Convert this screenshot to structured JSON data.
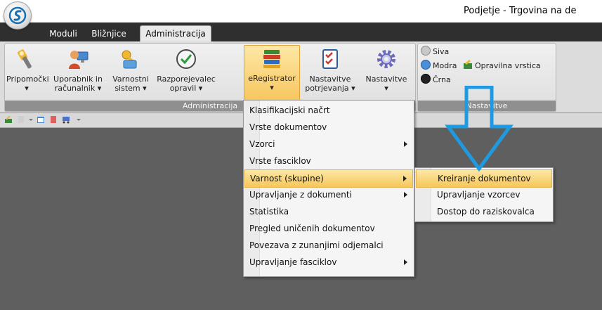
{
  "window": {
    "title": "Podjetje - Trgovina na de"
  },
  "tabs": [
    {
      "label": "Moduli"
    },
    {
      "label": "Bližnjice"
    },
    {
      "label": "Administracija"
    }
  ],
  "ribbon": {
    "group_admin": {
      "label": "Administracija",
      "buttons": [
        {
          "line1": "Pripomočki",
          "line2": "▾",
          "icon": "tools-icon"
        },
        {
          "line1": "Uporabnik in",
          "line2": "računalnik ▾",
          "icon": "user-computer-icon"
        },
        {
          "line1": "Varnostni",
          "line2": "sistem ▾",
          "icon": "security-keys-icon"
        },
        {
          "line1": "Razporejevalec",
          "line2": "opravil ▾",
          "icon": "scheduler-clock-icon"
        },
        {
          "line1": "eRegistrator",
          "line2": "▾",
          "icon": "books-icon"
        },
        {
          "line1": "Nastavitve",
          "line2": "potrjevanja ▾",
          "icon": "checklist-icon"
        },
        {
          "line1": "Nastavitve",
          "line2": "▾",
          "icon": "gear-icon"
        }
      ]
    },
    "group_settings": {
      "label": "Nastavitve",
      "themes": [
        {
          "label": "Siva",
          "color": "#c8c8c8"
        },
        {
          "label": "Modra",
          "color": "#4a90d9"
        },
        {
          "label": "Črna",
          "color": "#222222"
        }
      ],
      "taskbar_label": "Opravilna vrstica"
    }
  },
  "menu": {
    "items": [
      {
        "label": "Klasifikacijski načrt",
        "submenu": false
      },
      {
        "label": "Vrste dokumentov",
        "submenu": false
      },
      {
        "label": "Vzorci",
        "submenu": true
      },
      {
        "label": "Vrste fasciklov",
        "submenu": false
      },
      {
        "label": "Varnost (skupine)",
        "submenu": true,
        "highlighted": true
      },
      {
        "label": "Upravljanje z dokumenti",
        "submenu": true
      },
      {
        "label": "Statistika",
        "submenu": false
      },
      {
        "label": "Pregled uničenih dokumentov",
        "submenu": false
      },
      {
        "label": "Povezava z zunanjimi odjemalci",
        "submenu": false
      },
      {
        "label": "Upravljanje fasciklov",
        "submenu": true
      }
    ]
  },
  "submenu": {
    "items": [
      {
        "label": "Kreiranje dokumentov",
        "highlighted": true
      },
      {
        "label": "Upravljanje vzorcev"
      },
      {
        "label": "Dostop do raziskovalca"
      }
    ]
  },
  "colors": {
    "highlight": "#f6c75b",
    "annotation_arrow": "#1e9be0"
  }
}
